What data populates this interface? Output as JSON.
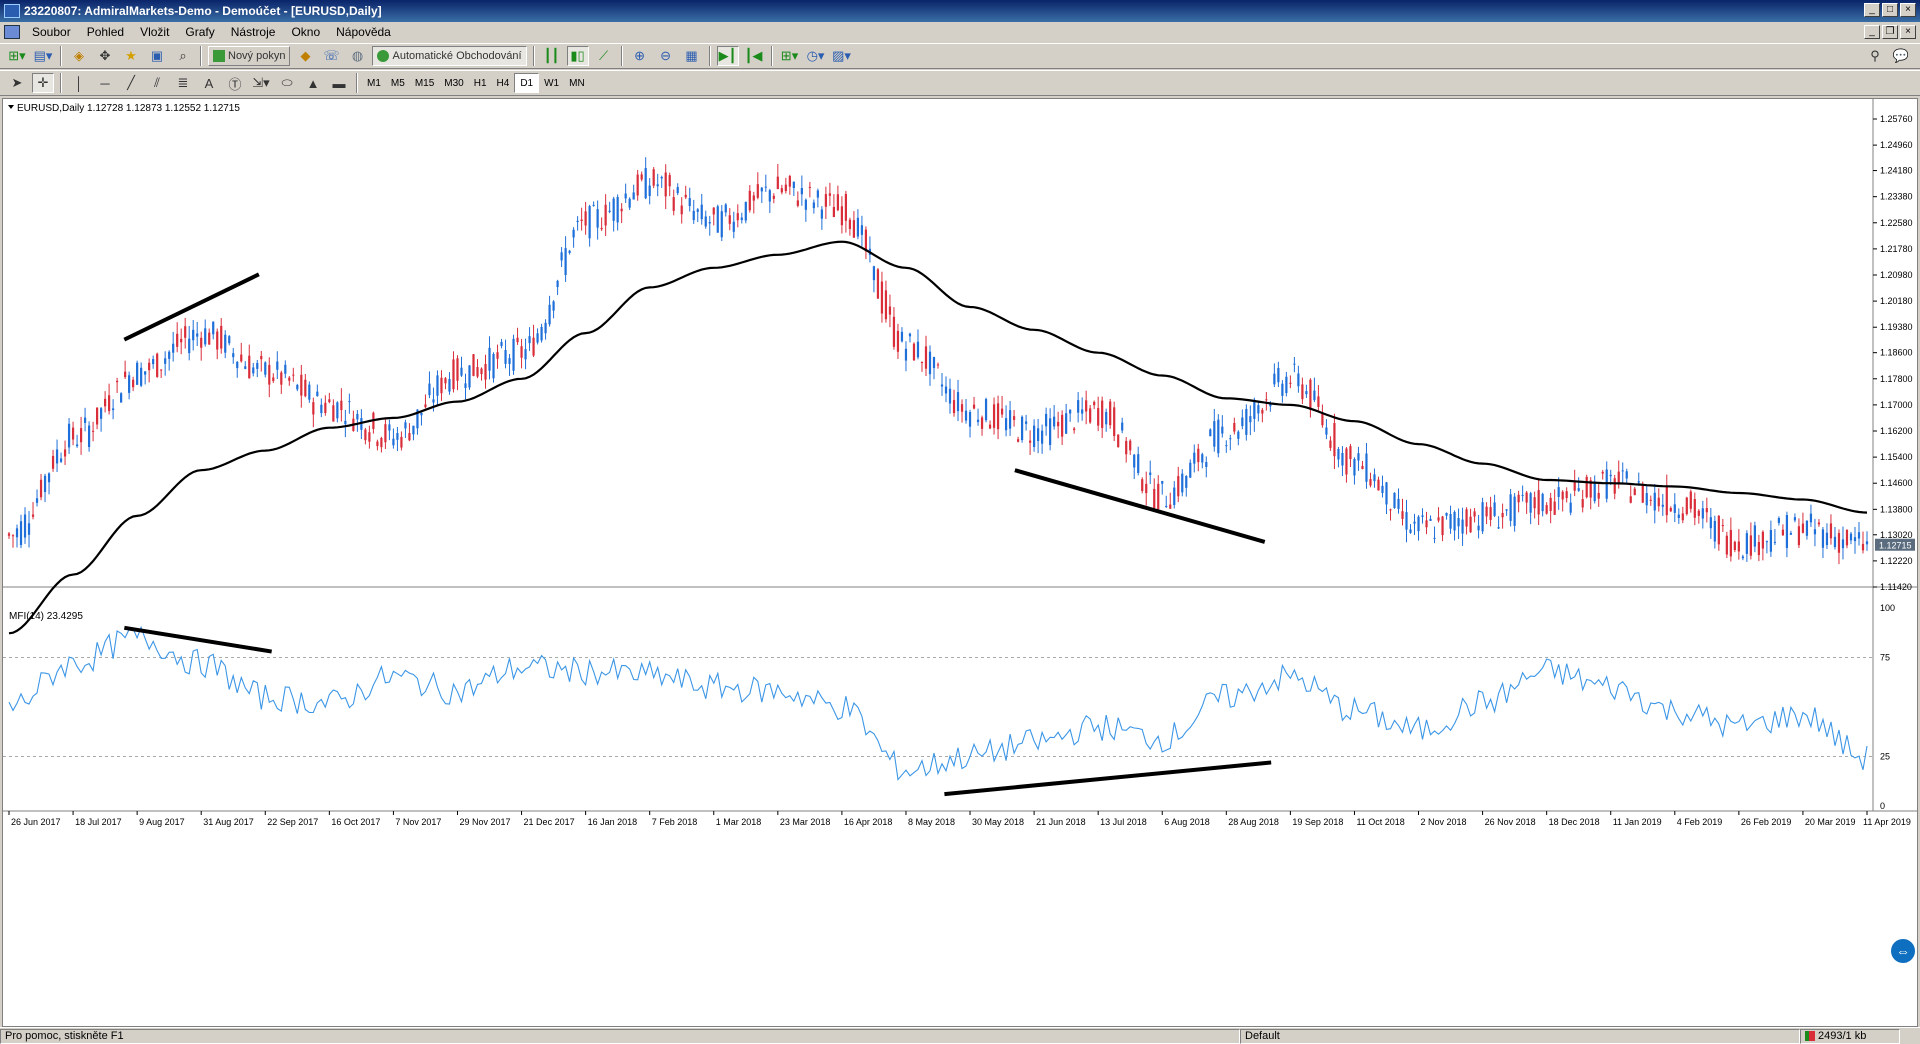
{
  "window": {
    "title": "23220807: AdmiralMarkets-Demo - Demoúčet - [EURUSD,Daily]"
  },
  "menu": [
    "Soubor",
    "Pohled",
    "Vložit",
    "Grafy",
    "Nástroje",
    "Okno",
    "Nápověda"
  ],
  "toolbar": {
    "new_order_label": "Nový pokyn",
    "autotrading_label": "Automatické Obchodování"
  },
  "timeframes": [
    "M1",
    "M5",
    "M15",
    "M30",
    "H1",
    "H4",
    "D1",
    "W1",
    "MN"
  ],
  "active_timeframe": "D1",
  "chart": {
    "header": "EURUSD,Daily  1.12728 1.12873 1.12552 1.12715",
    "current_price": "1.12715",
    "price_ticks": [
      "1.25760",
      "1.24960",
      "1.24180",
      "1.23380",
      "1.22580",
      "1.21780",
      "1.20980",
      "1.20180",
      "1.19380",
      "1.18600",
      "1.17800",
      "1.17000",
      "1.16200",
      "1.15400",
      "1.14600",
      "1.13800",
      "1.13020",
      "1.12220",
      "1.11420"
    ],
    "indicator_header": "MFI(14) 23.4295",
    "indicator_ticks": [
      "100",
      "75",
      "25",
      "0"
    ],
    "date_ticks": [
      "26 Jun 2017",
      "18 Jul 2017",
      "9 Aug 2017",
      "31 Aug 2017",
      "22 Sep 2017",
      "16 Oct 2017",
      "7 Nov 2017",
      "29 Nov 2017",
      "21 Dec 2017",
      "16 Jan 2018",
      "7 Feb 2018",
      "1 Mar 2018",
      "23 Mar 2018",
      "16 Apr 2018",
      "8 May 2018",
      "30 May 2018",
      "21 Jun 2018",
      "13 Jul 2018",
      "6 Aug 2018",
      "28 Aug 2018",
      "19 Sep 2018",
      "11 Oct 2018",
      "2 Nov 2018",
      "26 Nov 2018",
      "18 Dec 2018",
      "11 Jan 2019",
      "4 Feb 2019",
      "26 Feb 2019",
      "20 Mar 2019",
      "11 Apr 2019"
    ],
    "colors": {
      "bull": "#1e6fd9",
      "bear": "#d92d3a",
      "ma": "#000000",
      "mfi": "#3c96e6"
    }
  },
  "chart_data": {
    "type": "line",
    "symbol": "EURUSD",
    "timeframe": "Daily",
    "x": [
      "26 Jun 2017",
      "18 Jul 2017",
      "9 Aug 2017",
      "31 Aug 2017",
      "22 Sep 2017",
      "16 Oct 2017",
      "7 Nov 2017",
      "29 Nov 2017",
      "21 Dec 2017",
      "16 Jan 2018",
      "7 Feb 2018",
      "1 Mar 2018",
      "23 Mar 2018",
      "16 Apr 2018",
      "8 May 2018",
      "30 May 2018",
      "21 Jun 2018",
      "13 Jul 2018",
      "6 Aug 2018",
      "28 Aug 2018",
      "19 Sep 2018",
      "11 Oct 2018",
      "2 Nov 2018",
      "26 Nov 2018",
      "18 Dec 2018",
      "11 Jan 2019",
      "4 Feb 2019",
      "26 Feb 2019",
      "20 Mar 2019",
      "11 Apr 2019"
    ],
    "series": [
      {
        "values": [
          1.13,
          1.16,
          1.18,
          1.192,
          1.18,
          1.17,
          1.16,
          1.18,
          1.186,
          1.226,
          1.238,
          1.226,
          1.236,
          1.23,
          1.188,
          1.168,
          1.162,
          1.168,
          1.142,
          1.162,
          1.178,
          1.152,
          1.132,
          1.136,
          1.14,
          1.146,
          1.14,
          1.128,
          1.132,
          1.127
        ]
      },
      {
        "values": [
          1.1,
          1.118,
          1.136,
          1.15,
          1.156,
          1.163,
          1.166,
          1.171,
          1.178,
          1.192,
          1.206,
          1.212,
          1.216,
          1.22,
          1.212,
          1.2,
          1.193,
          1.186,
          1.179,
          1.172,
          1.17,
          1.165,
          1.158,
          1.152,
          1.147,
          1.146,
          1.145,
          1.143,
          1.141,
          1.137
        ]
      },
      {
        "values": [
          50,
          72,
          85,
          72,
          55,
          52,
          65,
          58,
          70,
          68,
          66,
          60,
          58,
          50,
          18,
          25,
          32,
          40,
          34,
          55,
          65,
          48,
          38,
          52,
          68,
          60,
          48,
          40,
          46,
          24
        ]
      }
    ],
    "ylim": [
      1.1142,
      1.2576
    ],
    "ylim_indicator": [
      0,
      100
    ],
    "levels": [
      75,
      25
    ],
    "last_value": 1.12715,
    "indicator_last_value": 23.4295
  }
}
